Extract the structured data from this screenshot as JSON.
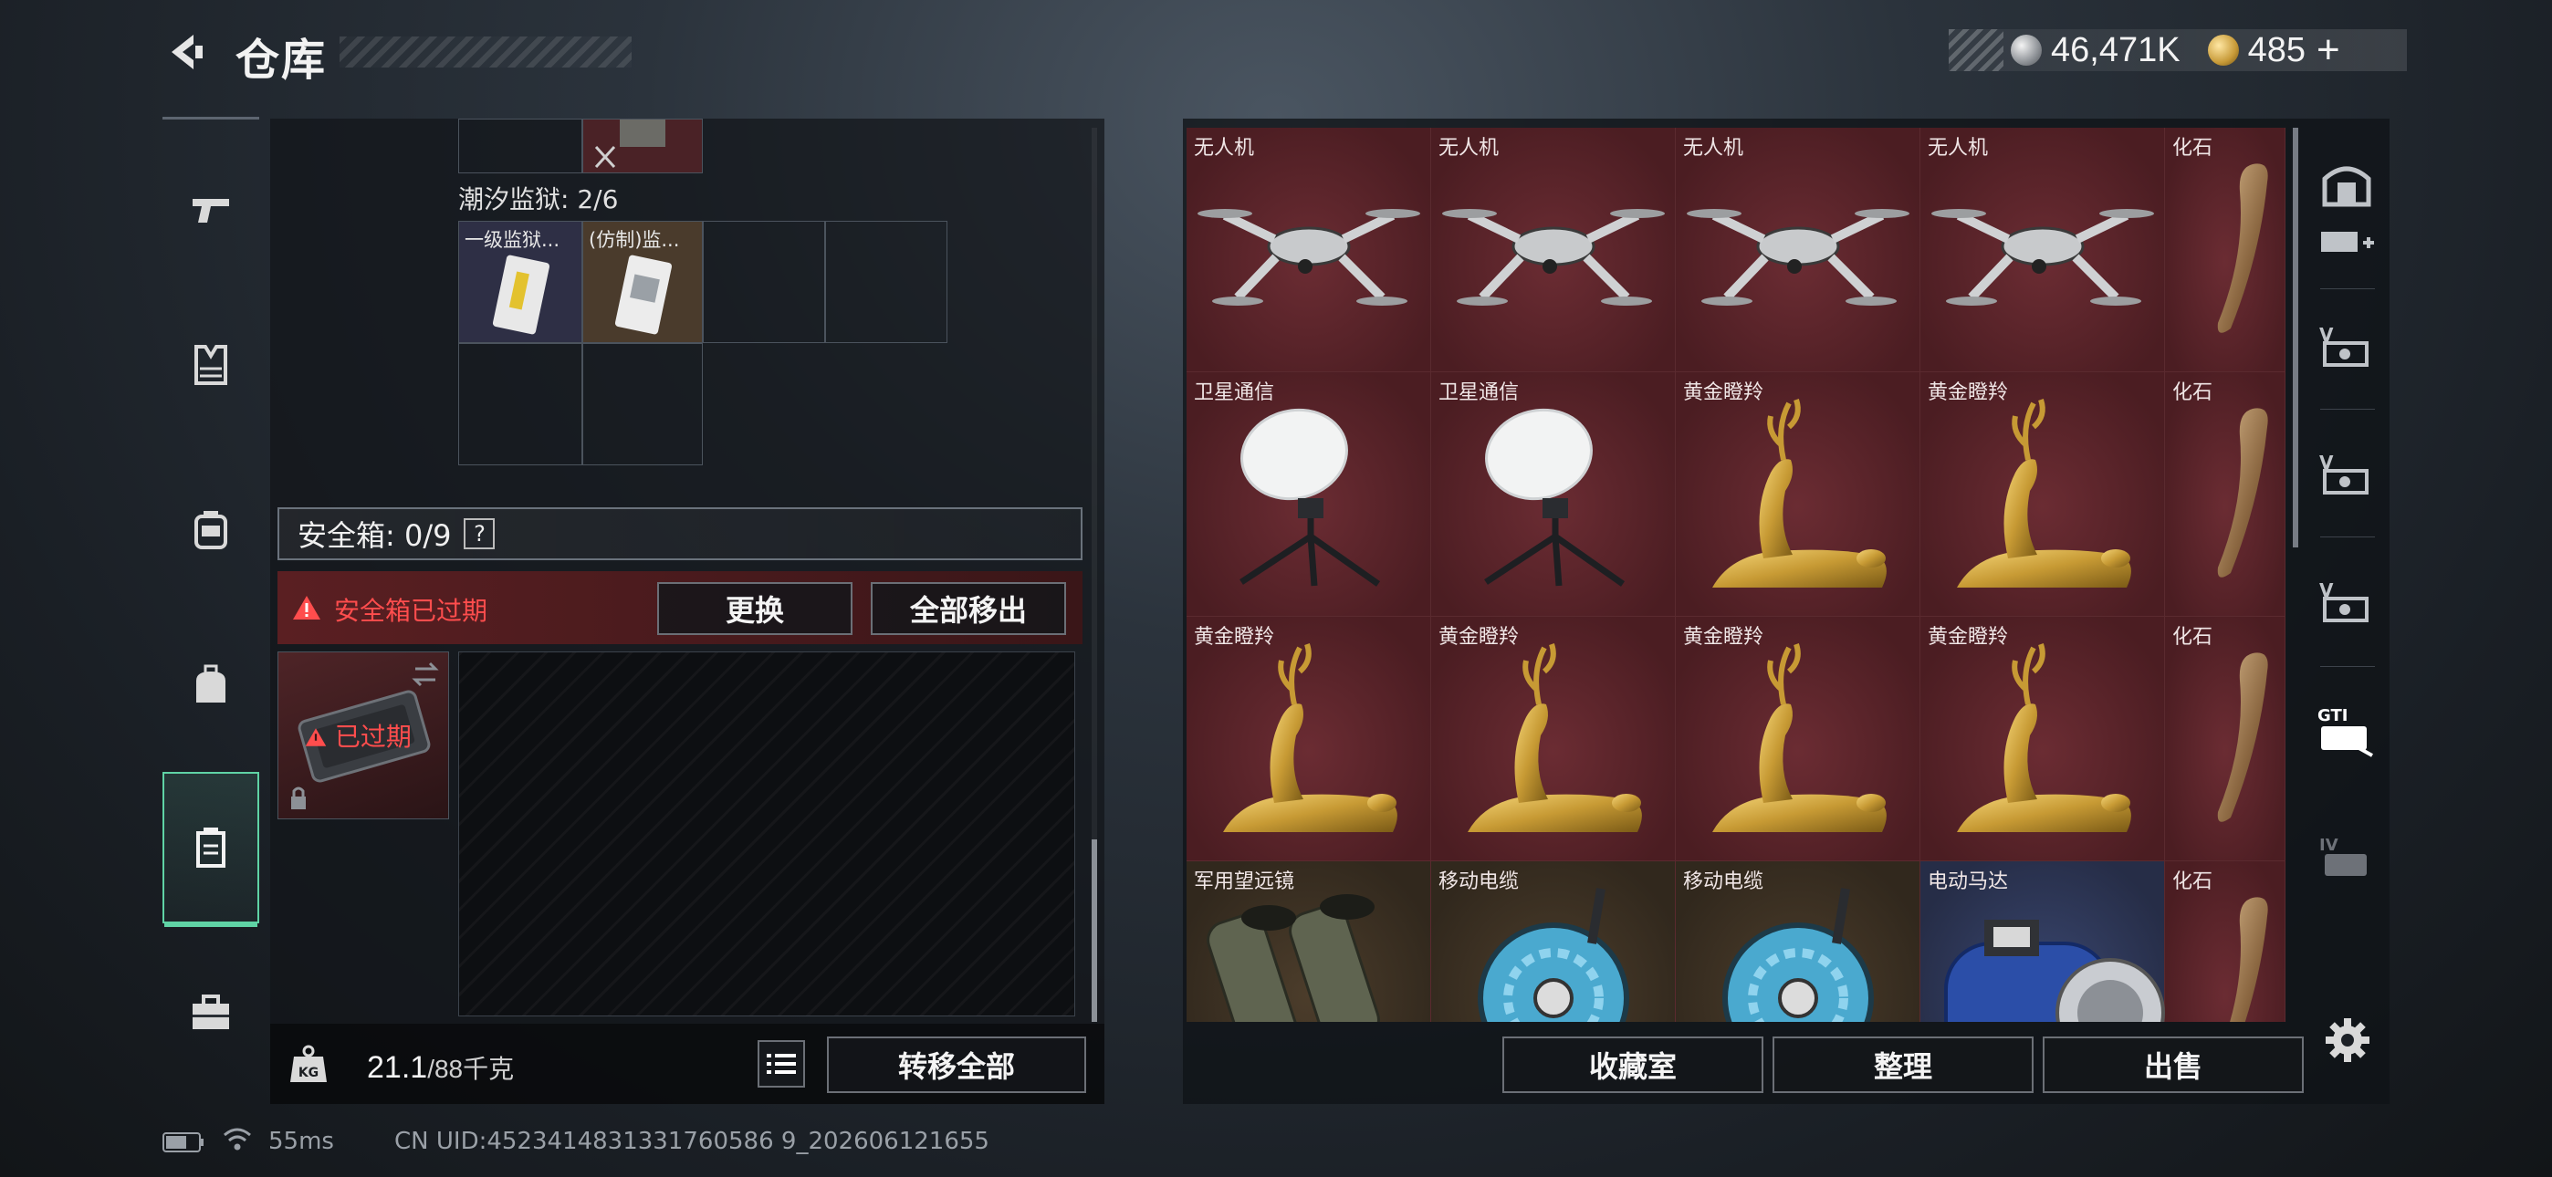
{
  "header": {
    "title": "仓库"
  },
  "currency": {
    "silver": "46,471K",
    "gold": "485",
    "gold_plus": "+"
  },
  "left_panel": {
    "prison_label": "潮汐监狱: 2/6",
    "prison_items": [
      "一级监狱...",
      "(仿制)监..."
    ],
    "safebox_label": "安全箱: 0/9",
    "help": "?",
    "expired_warning": "安全箱已过期",
    "replace_button": "更换",
    "move_all_out_button": "全部移出",
    "safebox_expired_tag": "已过期",
    "weight_current": "21.1",
    "weight_max": "/88千克",
    "transfer_all_button": "转移全部"
  },
  "items": [
    {
      "label": "无人机",
      "kind": "drone",
      "tone": "red"
    },
    {
      "label": "无人机",
      "kind": "drone",
      "tone": "red"
    },
    {
      "label": "无人机",
      "kind": "drone",
      "tone": "red"
    },
    {
      "label": "无人机",
      "kind": "drone",
      "tone": "red"
    },
    {
      "label": "化石",
      "kind": "fossil",
      "tone": "red"
    },
    {
      "label": "卫星通信",
      "kind": "dish",
      "tone": "red"
    },
    {
      "label": "卫星通信",
      "kind": "dish",
      "tone": "red"
    },
    {
      "label": "黄金瞪羚",
      "kind": "gazelle",
      "tone": "red"
    },
    {
      "label": "黄金瞪羚",
      "kind": "gazelle",
      "tone": "red"
    },
    {
      "label": "化石",
      "kind": "fossil",
      "tone": "red"
    },
    {
      "label": "黄金瞪羚",
      "kind": "gazelle",
      "tone": "red"
    },
    {
      "label": "黄金瞪羚",
      "kind": "gazelle",
      "tone": "red"
    },
    {
      "label": "黄金瞪羚",
      "kind": "gazelle",
      "tone": "red"
    },
    {
      "label": "黄金瞪羚",
      "kind": "gazelle",
      "tone": "red"
    },
    {
      "label": "化石",
      "kind": "fossil",
      "tone": "red"
    },
    {
      "label": "军用望远镜",
      "kind": "binoculars",
      "tone": "brown"
    },
    {
      "label": "移动电缆",
      "kind": "cable",
      "tone": "brown"
    },
    {
      "label": "移动电缆",
      "kind": "cable",
      "tone": "brown"
    },
    {
      "label": "电动马达",
      "kind": "motor",
      "tone": "blue"
    },
    {
      "label": "化石",
      "kind": "fossil",
      "tone": "red"
    }
  ],
  "bottom_buttons": {
    "collection": "收藏室",
    "sort": "整理",
    "sell": "出售"
  },
  "tools": [
    {
      "icon": "vault-icon"
    },
    {
      "icon": "add-container-icon"
    },
    {
      "icon": "v-card-icon"
    },
    {
      "icon": "v-card-icon"
    },
    {
      "icon": "v-card-icon"
    },
    {
      "icon": "gti-card-icon"
    },
    {
      "icon": "iv-card-icon"
    }
  ],
  "status": {
    "ping": "55ms",
    "uid": "CN UID:4523414831331760586 9_202606121655"
  },
  "colors": {
    "accent_green": "#5fd3a5",
    "warning_red": "#ff4d4d",
    "tile_red": "#4b1d22"
  }
}
